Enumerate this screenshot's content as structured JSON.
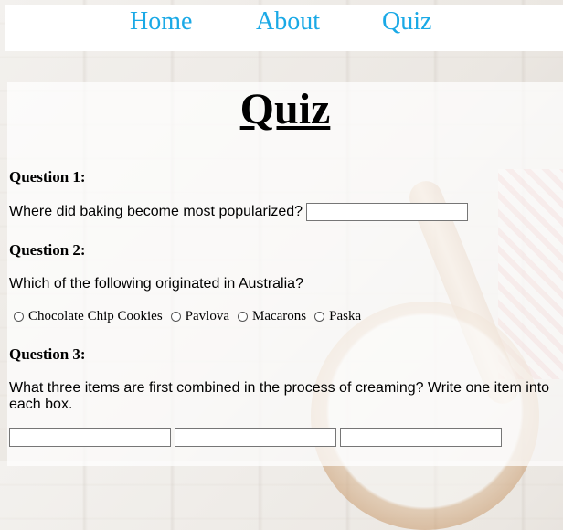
{
  "nav": {
    "home": "Home",
    "about": "About",
    "quiz": "Quiz"
  },
  "page": {
    "title": "Quiz"
  },
  "questions": [
    {
      "heading": "Question 1:",
      "text": "Where did baking become most popularized?",
      "answer": ""
    },
    {
      "heading": "Question 2:",
      "text": "Which of the following originated in Australia?",
      "options": [
        "Chocolate Chip Cookies",
        "Pavlova",
        "Macarons",
        "Paska"
      ]
    },
    {
      "heading": "Question 3:",
      "text": "What three items are first combined in the process of creaming? Write one item into each box.",
      "answers": [
        "",
        "",
        ""
      ]
    }
  ]
}
